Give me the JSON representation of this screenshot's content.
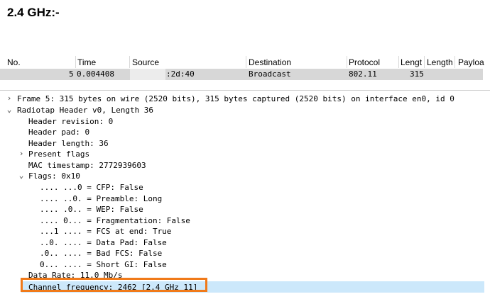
{
  "heading": "2.4 GHz:-",
  "packet_list": {
    "columns": [
      "No.",
      "Time",
      "Source",
      "Destination",
      "Protocol",
      "Lengt",
      "Length",
      "Payloa"
    ],
    "row": {
      "no": "5",
      "time": "0.004408",
      "source": ":2d:40",
      "destination": "Broadcast",
      "protocol": "802.11",
      "length": "315"
    }
  },
  "details": {
    "frame": "Frame 5: 315 bytes on wire (2520 bits), 315 bytes captured (2520 bits) on interface en0, id 0",
    "radiotap": "Radiotap Header v0, Length 36",
    "header_revision": "Header revision: 0",
    "header_pad": "Header pad: 0",
    "header_length": "Header length: 36",
    "present_flags": "Present flags",
    "mac_timestamp": "MAC timestamp: 2772939603",
    "flags": "Flags: 0x10",
    "flag_lines": [
      ".... ...0 = CFP: False",
      ".... ..0. = Preamble: Long",
      ".... .0.. = WEP: False",
      ".... 0... = Fragmentation: False",
      "...1 .... = FCS at end: True",
      "..0. .... = Data Pad: False",
      ".0.. .... = Bad FCS: False",
      "0... .... = Short GI: False"
    ],
    "data_rate": "Data Rate: 11.0 Mb/s",
    "channel_frequency": "Channel frequency: 2462 [2.4 GHz 11]"
  },
  "colors": {
    "highlight": "#f07a1a",
    "selected_row": "#cce8fb",
    "packet_row": "#d7d7d7"
  }
}
